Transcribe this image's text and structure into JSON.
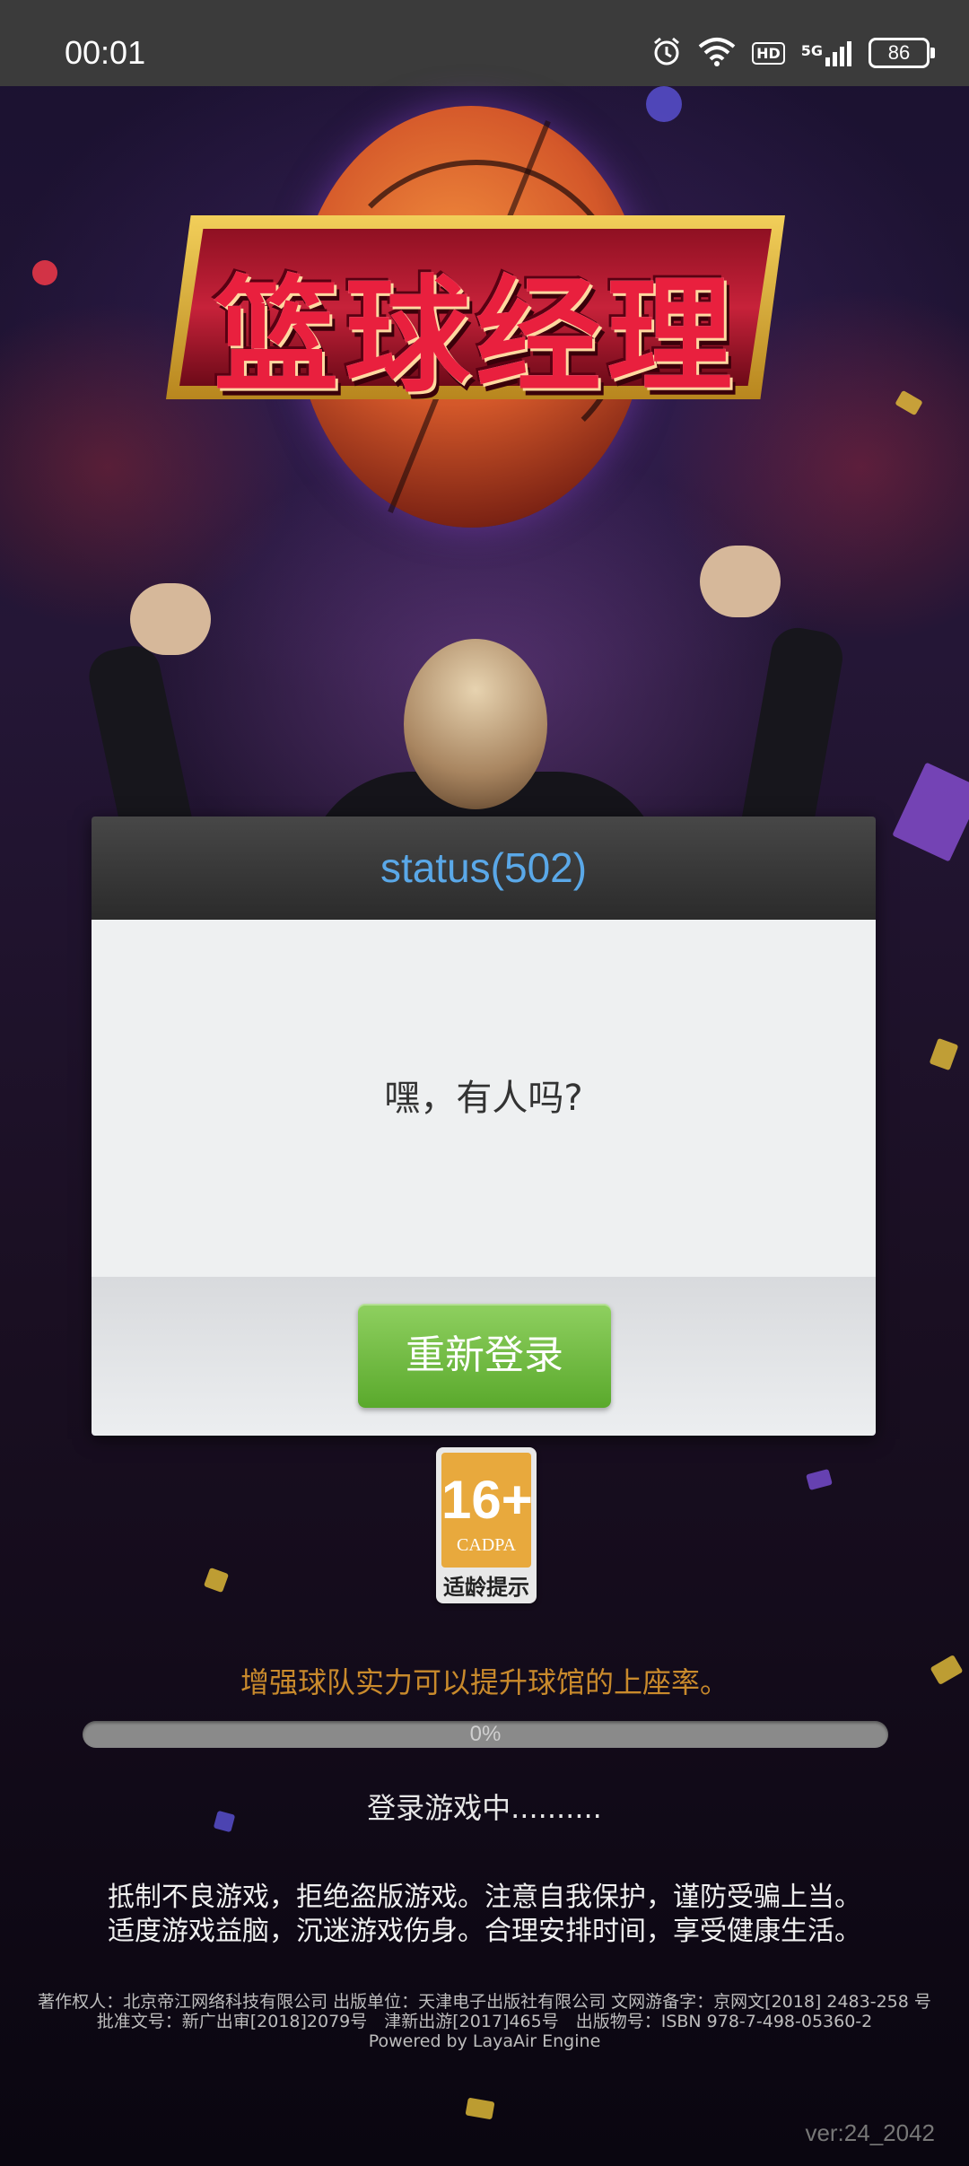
{
  "status_bar": {
    "time": "00:01",
    "icons": [
      "alarm-icon",
      "wifi-icon",
      "hd-icon",
      "5g-signal-icon",
      "battery-icon"
    ],
    "hd_label": "HD",
    "network_label": "5G",
    "battery_level": "86"
  },
  "game": {
    "logo_text": "篮球经理"
  },
  "dialog": {
    "title": "status(502)",
    "message": "嘿，有人吗?",
    "relogin_label": "重新登录",
    "title_color": "#5aa8e8",
    "button_color": "#6bbb3a"
  },
  "age_rating": {
    "age": "16+",
    "org": "CADPA",
    "label": "适龄提示"
  },
  "loading": {
    "tip": "增强球队实力可以提升球馆的上座率。",
    "progress_percent": 0,
    "progress_label": "0%",
    "status": "登录游戏中.........."
  },
  "health_notice": {
    "line1": "抵制不良游戏，拒绝盗版游戏。注意自我保护，谨防受骗上当。",
    "line2": "适度游戏益脑，沉迷游戏伤身。合理安排时间，享受健康生活。"
  },
  "copyright": {
    "line1": "著作权人：北京帝江网络科技有限公司 出版单位：天津电子出版社有限公司 文网游备字：京网文[2018] 2483-258 号",
    "line2": "批准文号：新广出审[2018]2079号　津新出游[2017]465号　出版物号：ISBN 978-7-498-05360-2",
    "line3": "Powered by LayaAir Engine"
  },
  "version": "ver:24_2042"
}
